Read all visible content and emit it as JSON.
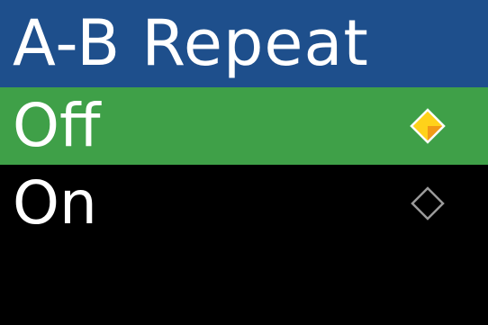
{
  "screen": {
    "title": "A-B Repeat",
    "options": [
      {
        "label": "Off",
        "selected": true,
        "marker_icon": "filled-diamond-icon"
      },
      {
        "label": "On",
        "selected": false,
        "marker_icon": "outline-diamond-icon"
      }
    ]
  },
  "colors": {
    "title_bar": "#1e4f8c",
    "selected_row": "#3fa048",
    "background": "#000000",
    "text": "#ffffff",
    "marker_selected_fill": "#ffd21a",
    "marker_unselected_outline": "#9a9a9a"
  }
}
